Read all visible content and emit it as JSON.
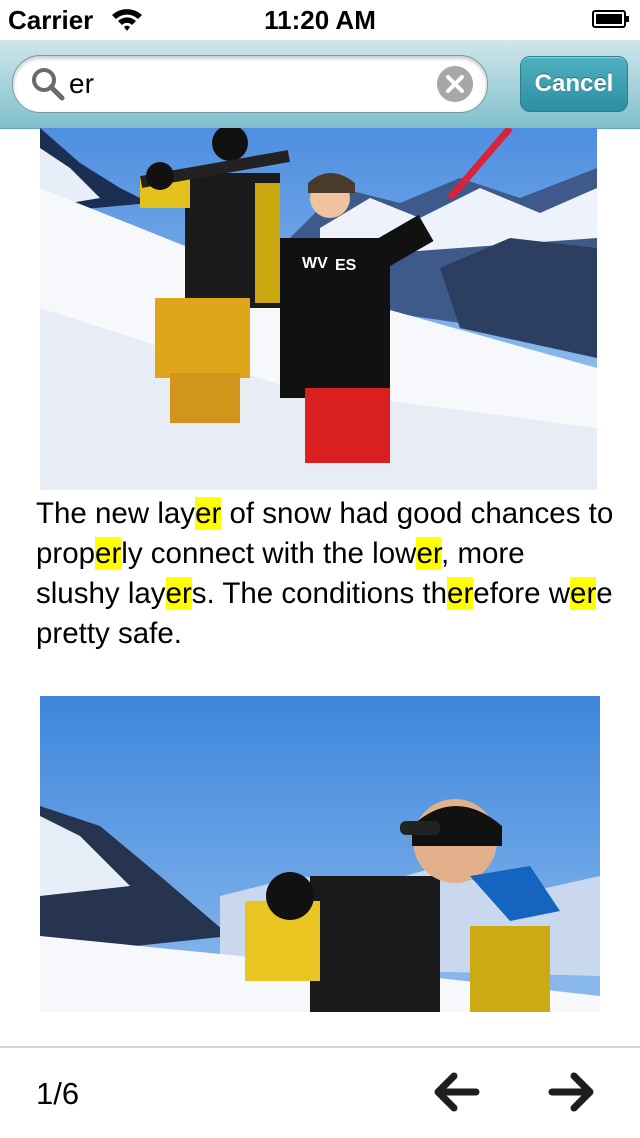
{
  "status_bar": {
    "carrier": "Carrier",
    "time": "11:20 AM"
  },
  "search": {
    "value": "er",
    "cancel_label": "Cancel",
    "icons": [
      "search-icon",
      "clear-icon"
    ]
  },
  "article": {
    "paragraph": [
      {
        "t": "The new lay"
      },
      {
        "t": "er",
        "hl": true
      },
      {
        "t": " of snow had good chances to prop"
      },
      {
        "t": "er",
        "hl": true
      },
      {
        "t": "ly connect with the low"
      },
      {
        "t": "er",
        "hl": true
      },
      {
        "t": ", more slushy lay"
      },
      {
        "t": "er",
        "hl": true
      },
      {
        "t": "s. The conditions th"
      },
      {
        "t": "er",
        "hl": true
      },
      {
        "t": "efore w"
      },
      {
        "t": "er",
        "hl": true
      },
      {
        "t": "e pretty safe."
      }
    ],
    "image_1": "photo of two snowboarders standing in deep snow",
    "image_2": "photo of a snowboarder carrying a board on the shoulder",
    "image_1_shirt_text": "WV",
    "image_1_shirt_text2": "ES"
  },
  "toolbar": {
    "page_indicator": "1/6",
    "prev_icon": "arrow-left-icon",
    "next_icon": "arrow-right-icon"
  },
  "colors": {
    "highlight": "#ffff00",
    "accent": "#2c8ea0",
    "bar": "#7fc0cc"
  }
}
